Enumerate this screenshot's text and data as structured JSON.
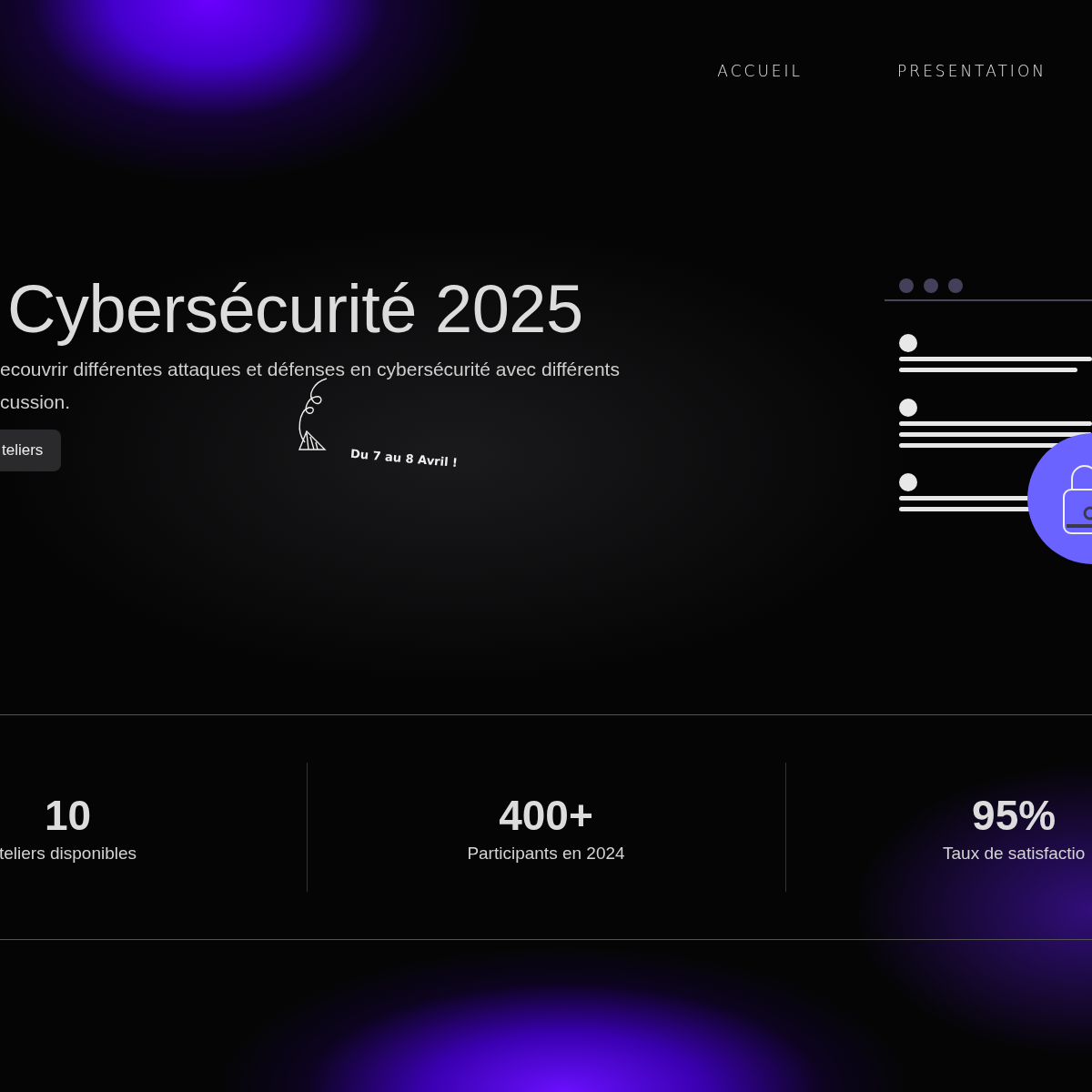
{
  "nav": {
    "items": [
      {
        "label": "ACCUEIL"
      },
      {
        "label": "PRESENTATION"
      }
    ]
  },
  "hero": {
    "title": "Cybersécurité 2025",
    "lines": [
      "ecouvrir différentes attaques et défenses en cybersécurité avec différents",
      "cussion."
    ],
    "button": "teliers",
    "note": "Du 7 au 8 Avril !"
  },
  "stats": [
    {
      "value": "10",
      "label": "teliers disponibles"
    },
    {
      "value": "400+",
      "label": "Participants en 2024"
    },
    {
      "value": "95%",
      "label": "Taux de satisfactio"
    }
  ]
}
